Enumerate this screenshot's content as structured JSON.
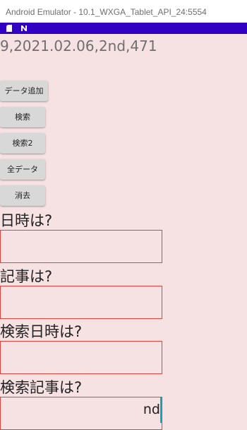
{
  "window": {
    "title": "Android Emulator - 10.1_WXGA_Tablet_API_24:5554"
  },
  "status_bar": {
    "color": "#3100c2",
    "icons": [
      "sd-card-icon",
      "notification-n-icon"
    ]
  },
  "result_text": "9,2021.02.06,2nd,471",
  "buttons": {
    "add_data": "データ追加",
    "search": "検索",
    "search2": "検索2",
    "all_data": "全データ",
    "clear": "消去"
  },
  "form": {
    "datetime_label": "日時は?",
    "datetime_value": "",
    "article_label": "記事は?",
    "article_value": "",
    "search_datetime_label": "検索日時は?",
    "search_datetime_value": "",
    "search_article_label": "検索記事は?",
    "search_article_value": "nd"
  },
  "colors": {
    "background": "#f6e1e3",
    "field_border": "#e2433f",
    "cursor": "#1aa7b7"
  }
}
